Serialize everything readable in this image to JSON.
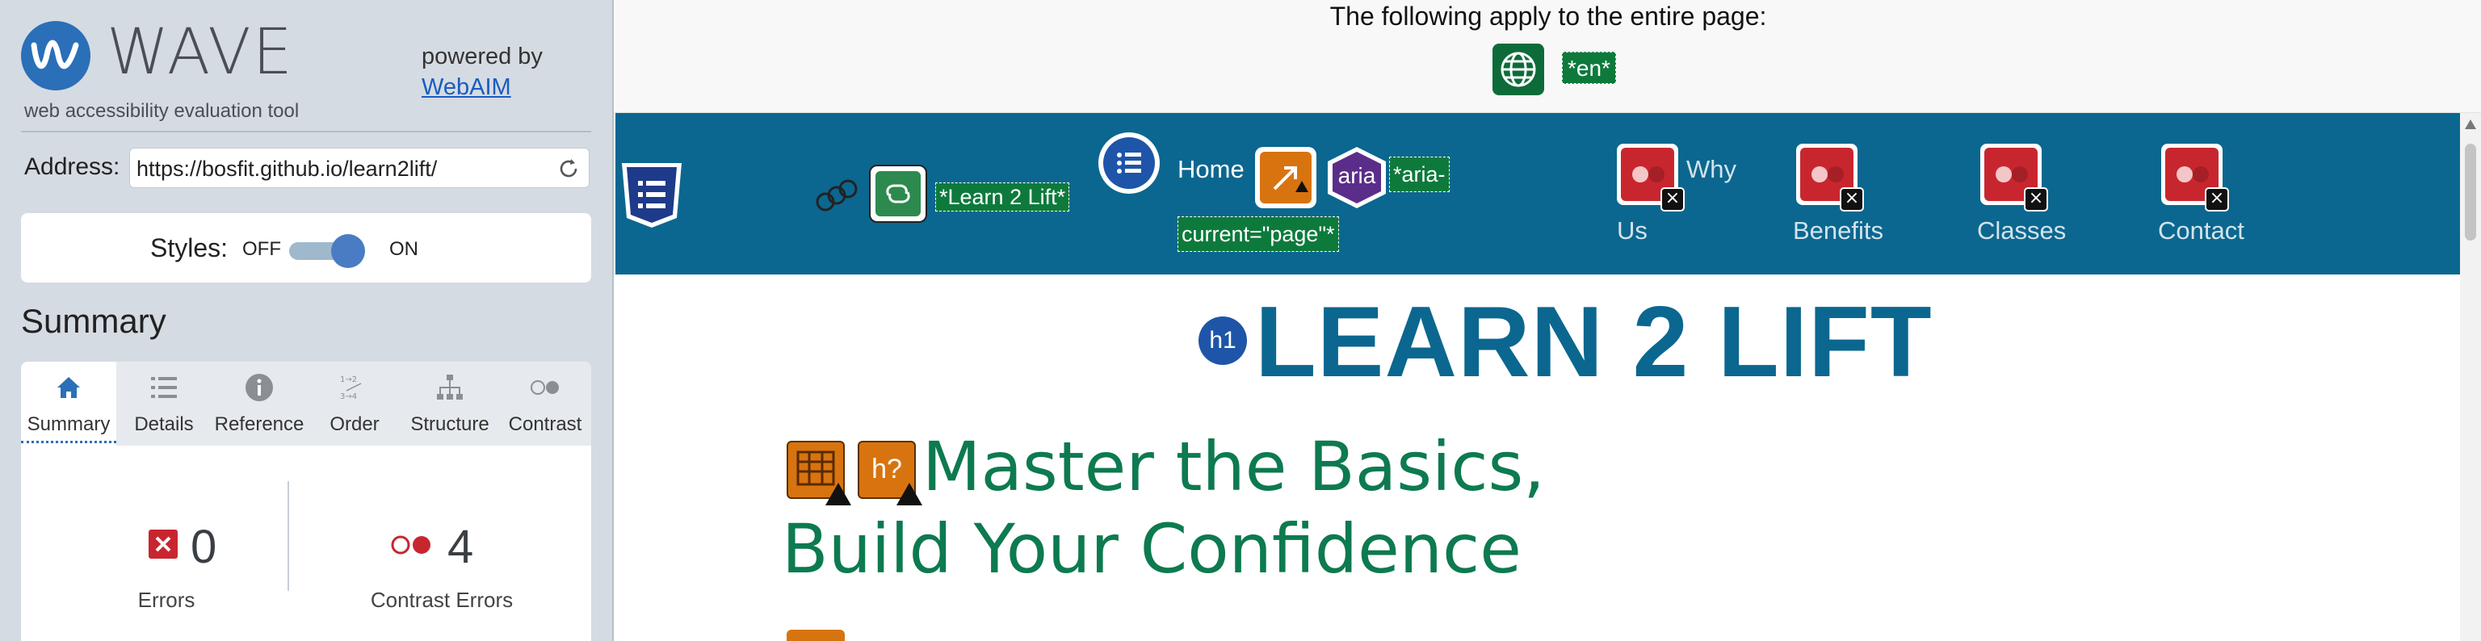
{
  "wave": {
    "logo_text": "WAVE",
    "tagline": "web accessibility evaluation tool",
    "powered_by": "powered by",
    "webaim_link": "WebAIM"
  },
  "address": {
    "label": "Address:",
    "value": "https://bosfit.github.io/learn2lift/"
  },
  "styles": {
    "label": "Styles:",
    "off": "OFF",
    "on": "ON",
    "enabled": true
  },
  "summary": {
    "heading": "Summary",
    "tabs": [
      {
        "label": "Summary",
        "icon": "home-icon",
        "active": true
      },
      {
        "label": "Details",
        "icon": "list-icon"
      },
      {
        "label": "Reference",
        "icon": "info-icon"
      },
      {
        "label": "Order",
        "icon": "order-icon"
      },
      {
        "label": "Structure",
        "icon": "structure-icon"
      },
      {
        "label": "Contrast",
        "icon": "contrast-icon"
      }
    ],
    "errors_count": "0",
    "errors_label": "Errors",
    "contrast_count": "4",
    "contrast_label": "Contrast Errors"
  },
  "preview": {
    "banner_text": "The following apply to the entire page:",
    "lang_tag": "*en*",
    "logo_alt_tag": "*Learn 2 Lift*",
    "nav_home": "Home",
    "aria_label": "aria",
    "aria_current_1": "*aria-",
    "aria_current_2": "current=\"page\"*",
    "nav_why_a": "Why",
    "nav_why_b": "Us",
    "nav_benefits": "Benefits",
    "nav_classes": "Classes",
    "nav_contact": "Contact",
    "h1_badge": "h1",
    "main_heading": "LEARN 2 LIFT",
    "tagline_1": "Master the Basics,",
    "tagline_2": "Build Your Confidence",
    "h_question": "h?"
  },
  "colors": {
    "panel_bg": "#d5dbe2",
    "nav_bg": "#0b678f",
    "error_red": "#c8262f",
    "alert_orange": "#d8740f",
    "feature_green": "#0d7a3c",
    "heading_blue": "#0b678f",
    "tagline_green": "#0d7a4f"
  }
}
